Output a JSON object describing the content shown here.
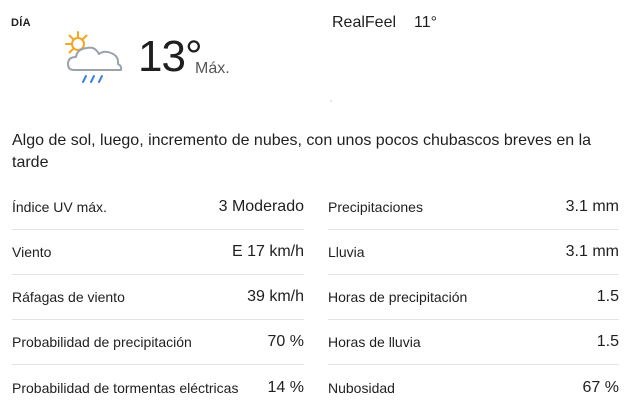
{
  "header": {
    "day_label": "DÍA",
    "temperature": "13°",
    "temperature_suffix": "Máx.",
    "realfeel_label": "RealFeel",
    "realfeel_value": "11°",
    "icon": "partly-sunny-showers-icon"
  },
  "phrase": "Algo de sol, luego, incremento de nubes, con unos pocos chubascos breves en la tarde",
  "details_left": [
    {
      "label": "Índice UV máx.",
      "value": "3 Moderado"
    },
    {
      "label": "Viento",
      "value": "E 17 km/h"
    },
    {
      "label": "Ráfagas de viento",
      "value": "39 km/h"
    },
    {
      "label": "Probabilidad de precipitación",
      "value": "70 %"
    },
    {
      "label": "Probabilidad de tormentas eléctricas",
      "value": "14 %"
    }
  ],
  "details_right": [
    {
      "label": "Precipitaciones",
      "value": "3.1 mm"
    },
    {
      "label": "Lluvia",
      "value": "3.1 mm"
    },
    {
      "label": "Horas de precipitación",
      "value": "1.5"
    },
    {
      "label": "Horas de lluvia",
      "value": "1.5"
    },
    {
      "label": "Nubosidad",
      "value": "67 %"
    }
  ],
  "colors": {
    "sun": "#f5a623",
    "cloud": "#9aa3ab",
    "rain": "#3b7fd6"
  }
}
